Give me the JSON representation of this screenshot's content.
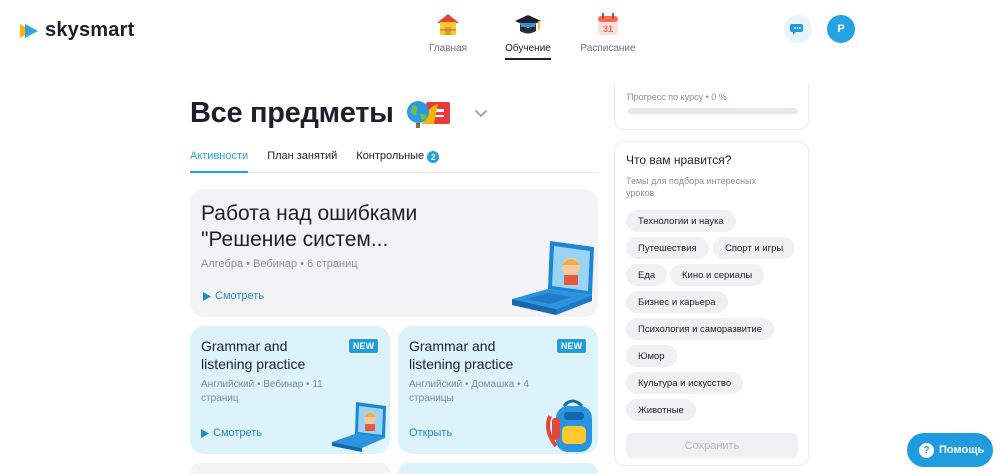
{
  "header": {
    "logo_text": "skysmart",
    "nav": [
      {
        "label": "Главная",
        "icon": "house-icon",
        "active": false
      },
      {
        "label": "Обучение",
        "icon": "graduation-cap-icon",
        "active": true
      },
      {
        "label": "Расписание",
        "icon": "calendar-icon",
        "active": false,
        "calendar_day": "31"
      }
    ],
    "avatar_letter": "Р"
  },
  "main": {
    "title": "Все предметы",
    "tabs": [
      {
        "label": "Активности",
        "active": true
      },
      {
        "label": "План занятий",
        "active": false
      },
      {
        "label": "Контрольные",
        "active": false,
        "badge": "2"
      }
    ],
    "cards": [
      {
        "title": "Работа над ошибками \"Решение систем...",
        "meta": "Алгебра • Вебинар • 6 страниц",
        "action": "Смотреть",
        "illustration": "laptop-icon"
      },
      {
        "title": "Grammar and listening practice",
        "meta": "Английский • Вебинар • 11 страниц",
        "action": "Смотреть",
        "badge": "NEW",
        "illustration": "laptop-icon"
      },
      {
        "title": "Grammar and listening practice",
        "meta": "Английский • Домашка • 4 страницы",
        "action": "Открыть",
        "badge": "NEW",
        "illustration": "backpack-icon"
      }
    ]
  },
  "sidebar": {
    "progress": {
      "label": "Прогресс по курсу • 0 %",
      "value_percent": 0
    },
    "likes": {
      "title": "Что вам нравится?",
      "subtitle": "Темы для подбора интересных уроков",
      "chips": [
        "Технологии и наука",
        "Путешествия",
        "Спорт и игры",
        "Еда",
        "Кино и сериалы",
        "Бизнес и карьера",
        "Психология и саморазвитие",
        "Юмор",
        "Культура и искусство",
        "Животные"
      ],
      "save_label": "Сохранить"
    }
  },
  "help": {
    "label": "Помощь"
  },
  "colors": {
    "accent": "#23a3e3",
    "card_blue": "#ddf3fc",
    "card_gray": "#f3f3f6"
  }
}
